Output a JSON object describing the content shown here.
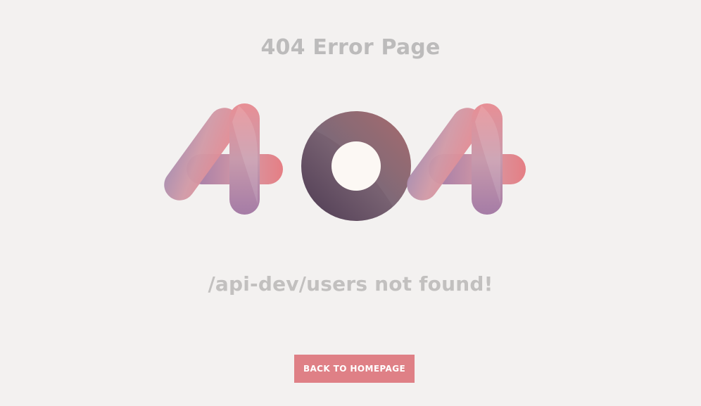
{
  "page": {
    "title": "404 Error Page",
    "graphic_digits": [
      "4",
      "0",
      "4"
    ],
    "message": "/api-dev/users not found!"
  },
  "actions": {
    "back_label": "BACK TO HOMEPAGE"
  },
  "colors": {
    "background": "#f3f1f0",
    "title_text": "#bcbbbb",
    "message_text": "#c2c0bf",
    "button_background": "#df8086",
    "button_text": "#ffffff",
    "four_pink": "#e47f86",
    "four_lavender": "#a781aa",
    "zero_dark": "#563f57",
    "zero_mid": "#7b6171",
    "zero_rose": "#9a5e63",
    "zero_inner": "#fcf8f4"
  }
}
